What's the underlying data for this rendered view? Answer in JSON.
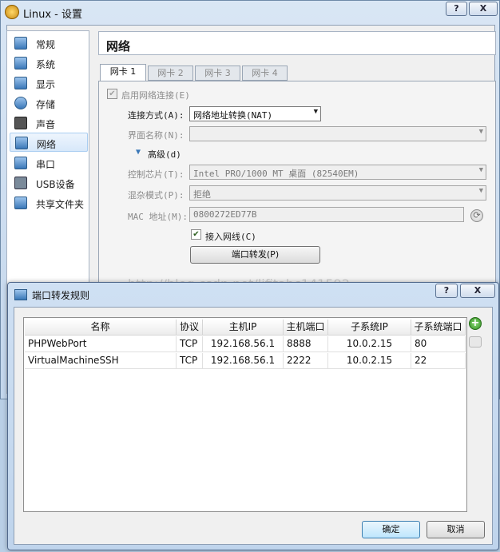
{
  "window": {
    "title": "Linux - 设置",
    "help_glyph": "?",
    "close_glyph": "X"
  },
  "sidebar": {
    "items": [
      {
        "label": "常规",
        "icon": "monitor-icon"
      },
      {
        "label": "系统",
        "icon": "chip-icon"
      },
      {
        "label": "显示",
        "icon": "display-icon"
      },
      {
        "label": "存储",
        "icon": "disk-icon"
      },
      {
        "label": "声音",
        "icon": "speaker-icon"
      },
      {
        "label": "网络",
        "icon": "network-icon"
      },
      {
        "label": "串口",
        "icon": "serial-port-icon"
      },
      {
        "label": "USB设备",
        "icon": "usb-icon"
      },
      {
        "label": "共享文件夹",
        "icon": "folder-icon"
      }
    ],
    "selected": "网络"
  },
  "section_title": "网络",
  "tabs": [
    "网卡 1",
    "网卡 2",
    "网卡 3",
    "网卡 4"
  ],
  "form": {
    "enable_label": "启用网络连接(E)",
    "attach_label": "连接方式(A):",
    "attach_value": "网络地址转换(NAT)",
    "name_label": "界面名称(N):",
    "name_value": "",
    "advanced_label": "高级(d)",
    "adapter_label": "控制芯片(T):",
    "adapter_value": "Intel PRO/1000 MT 桌面 (82540EM)",
    "promisc_label": "混杂模式(P):",
    "promisc_value": "拒绝",
    "mac_label": "MAC 地址(M):",
    "mac_value": "0800272ED77B",
    "cable_label": "接入网线(C)",
    "port_forward_label": "端口转发(P)"
  },
  "watermark": "http://blog.csdn.net/lifitabc141592",
  "dialog": {
    "title": "端口转发规则",
    "help_glyph": "?",
    "close_glyph": "X",
    "columns": [
      "名称",
      "协议",
      "主机IP",
      "主机端口",
      "子系统IP",
      "子系统端口"
    ],
    "rows": [
      [
        "PHPWebPort",
        "TCP",
        "192.168.56.1",
        "8888",
        "10.0.2.15",
        "80"
      ],
      [
        "VirtualMachineSSH",
        "TCP",
        "192.168.56.1",
        "2222",
        "10.0.2.15",
        "22"
      ]
    ],
    "ok_label": "确定",
    "cancel_label": "取消",
    "add_glyph": "+"
  },
  "colors": {
    "accent": "#3a78b8",
    "title_bar": "#c3d6ec",
    "selection": "#d7e8fa"
  }
}
